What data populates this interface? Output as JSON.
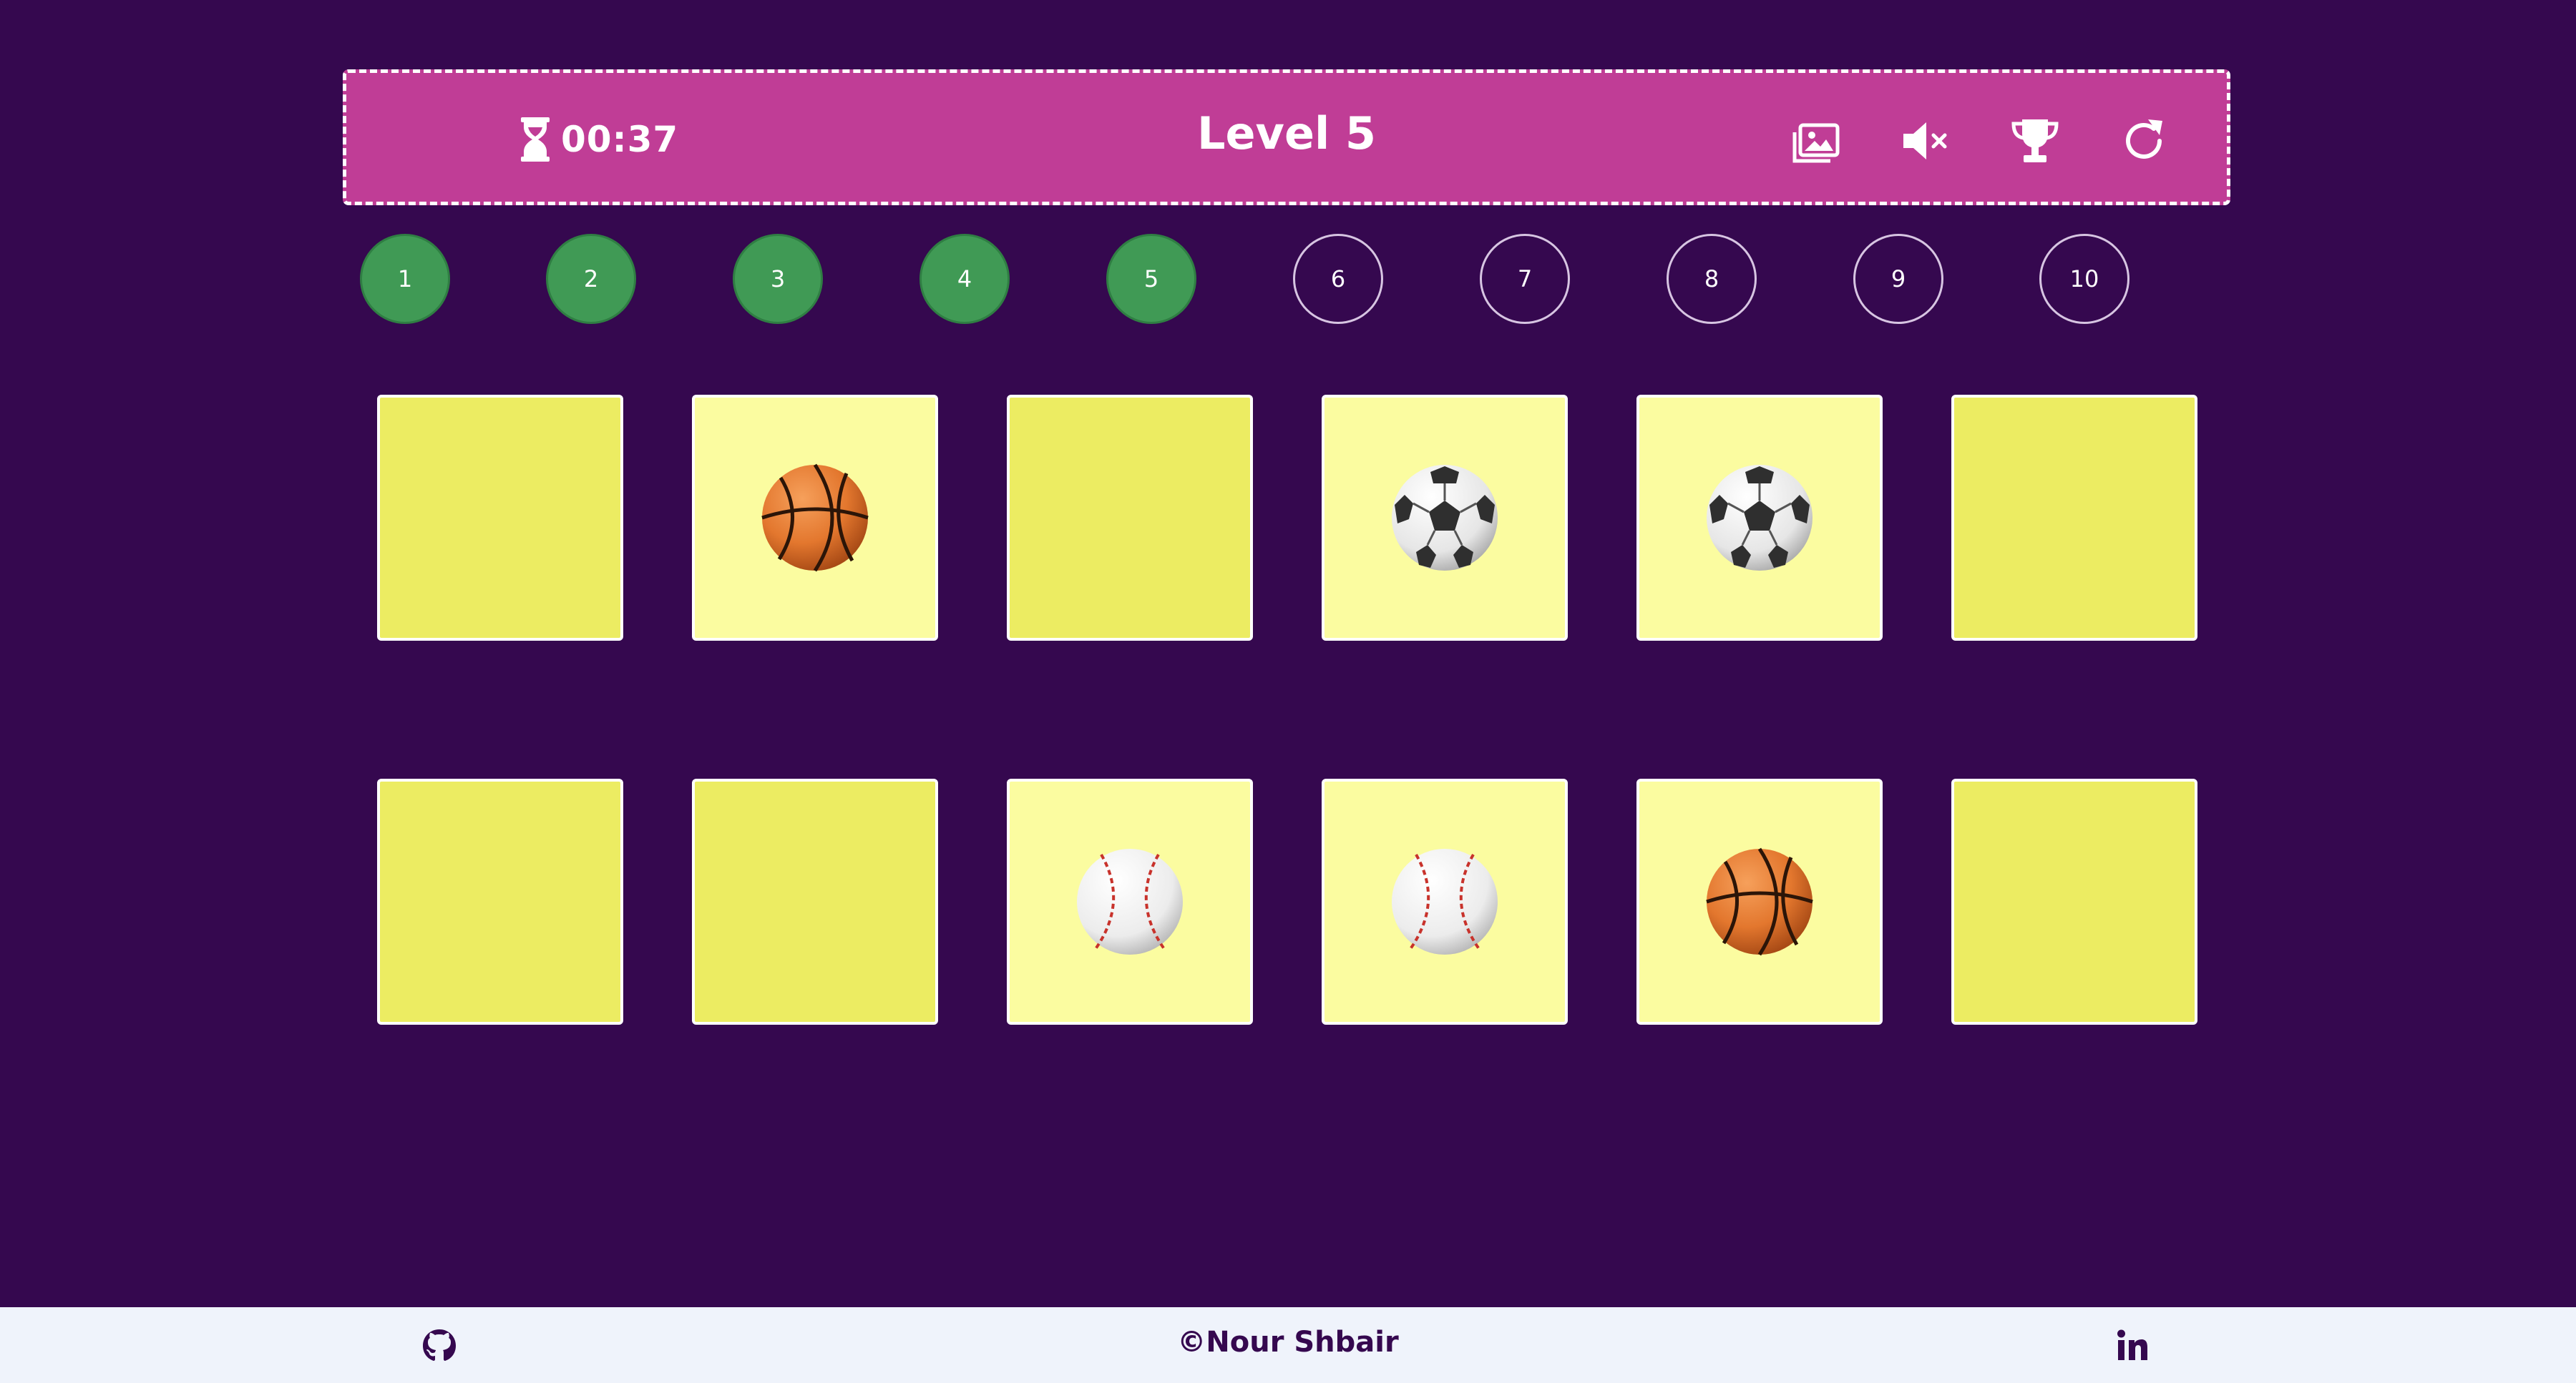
{
  "header": {
    "timer": "00:37",
    "level_title": "Level 5",
    "icons": [
      "hourglass-icon",
      "image-icon",
      "volume-mute-icon",
      "trophy-icon",
      "restart-icon"
    ]
  },
  "levels": [
    {
      "label": "1",
      "completed": true
    },
    {
      "label": "2",
      "completed": true
    },
    {
      "label": "3",
      "completed": true
    },
    {
      "label": "4",
      "completed": true
    },
    {
      "label": "5",
      "completed": true
    },
    {
      "label": "6",
      "completed": false
    },
    {
      "label": "7",
      "completed": false
    },
    {
      "label": "8",
      "completed": false
    },
    {
      "label": "9",
      "completed": false
    },
    {
      "label": "10",
      "completed": false
    }
  ],
  "cards": [
    {
      "flipped": false,
      "icon": null
    },
    {
      "flipped": true,
      "icon": "basketball-icon"
    },
    {
      "flipped": false,
      "icon": null
    },
    {
      "flipped": true,
      "icon": "soccer-ball-icon"
    },
    {
      "flipped": true,
      "icon": "soccer-ball-icon"
    },
    {
      "flipped": false,
      "icon": null
    },
    {
      "flipped": false,
      "icon": null
    },
    {
      "flipped": false,
      "icon": null
    },
    {
      "flipped": true,
      "icon": "baseball-icon"
    },
    {
      "flipped": true,
      "icon": "baseball-icon"
    },
    {
      "flipped": true,
      "icon": "basketball-icon"
    },
    {
      "flipped": false,
      "icon": null
    }
  ],
  "footer": {
    "copyright": "©Nour Shbair",
    "icons": [
      "github-icon",
      "linkedin-icon"
    ]
  },
  "colors": {
    "background": "#35084f",
    "header": "#c03d96",
    "level_completed": "#409a55",
    "card_hidden": "#ecec62",
    "card_flipped": "#fbfca0",
    "footer": "#eff3fb"
  }
}
